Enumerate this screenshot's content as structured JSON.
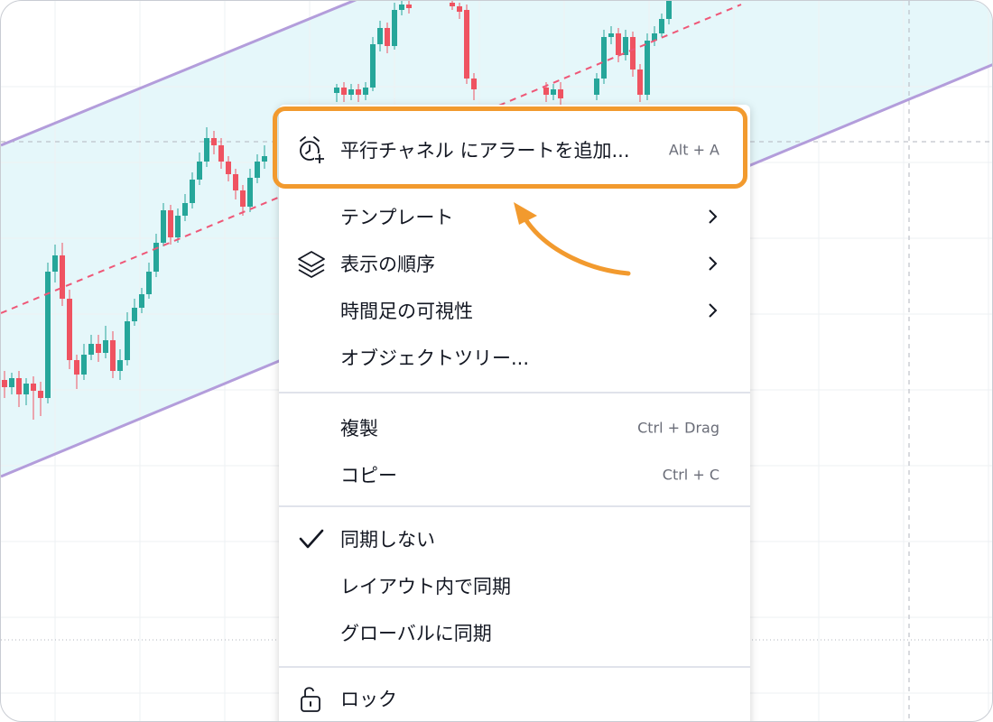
{
  "colors": {
    "channel_line": "#b39ddb",
    "channel_fill": "#e5f7fa",
    "median_line": "#ef5777",
    "candle_up": "#26a69a",
    "candle_down": "#ef5361",
    "grid": "#eef0f3",
    "crosshair": "#b2b5be",
    "highlight_border": "#f29a2e",
    "arrow": "#f29a2e"
  },
  "menu": {
    "add_alert": {
      "label": "平行チャネル にアラートを追加...",
      "shortcut": "Alt + A",
      "icon": "alarm-plus-icon"
    },
    "template": {
      "label": "テンプレート",
      "icon": "chevron-right-icon"
    },
    "visual_order": {
      "label": "表示の順序",
      "icon": "layers-icon"
    },
    "visibility": {
      "label": "時間足の可視性"
    },
    "object_tree": {
      "label": "オブジェクトツリー..."
    },
    "clone": {
      "label": "複製",
      "shortcut": "Ctrl + Drag"
    },
    "copy": {
      "label": "コピー",
      "shortcut": "Ctrl + C"
    },
    "no_sync": {
      "label": "同期しない",
      "checked": true,
      "icon": "checkmark-icon"
    },
    "sync_layout": {
      "label": "レイアウト内で同期"
    },
    "sync_global": {
      "label": "グローバルに同期"
    },
    "lock": {
      "label": "ロック",
      "icon": "unlock-icon"
    }
  }
}
